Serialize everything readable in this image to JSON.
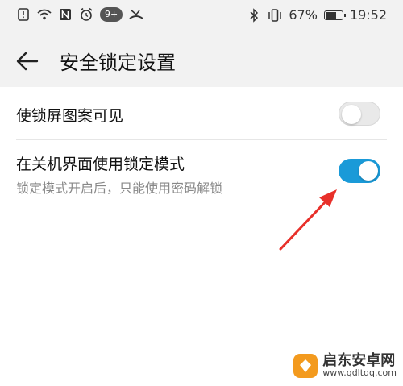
{
  "status_bar": {
    "notification_badge": "9+",
    "battery_percent": "67%",
    "battery_level": 0.67,
    "time": "19:52",
    "icons_left": [
      "alert-icon",
      "wifi-icon",
      "nfc-icon",
      "alarm-icon",
      "notification-badge",
      "missed-call-icon"
    ],
    "icons_right": [
      "bluetooth-icon",
      "vibrate-icon",
      "battery-icon"
    ]
  },
  "header": {
    "back_icon": "back-arrow-icon",
    "title": "安全锁定设置"
  },
  "settings": [
    {
      "label": "使锁屏图案可见",
      "subtitle": "",
      "toggle_on": false
    },
    {
      "label": "在关机界面使用锁定模式",
      "subtitle": "锁定模式开启后，只能使用密码解锁",
      "toggle_on": true
    }
  ],
  "colors": {
    "toggle_on": "#1a9ad8",
    "toggle_off": "#e9e9e9",
    "annotation_arrow": "#e8302a",
    "header_bg": "#f2f2f2"
  },
  "watermark": {
    "name": "启东安卓网",
    "url": "www.qdltdq.com"
  }
}
